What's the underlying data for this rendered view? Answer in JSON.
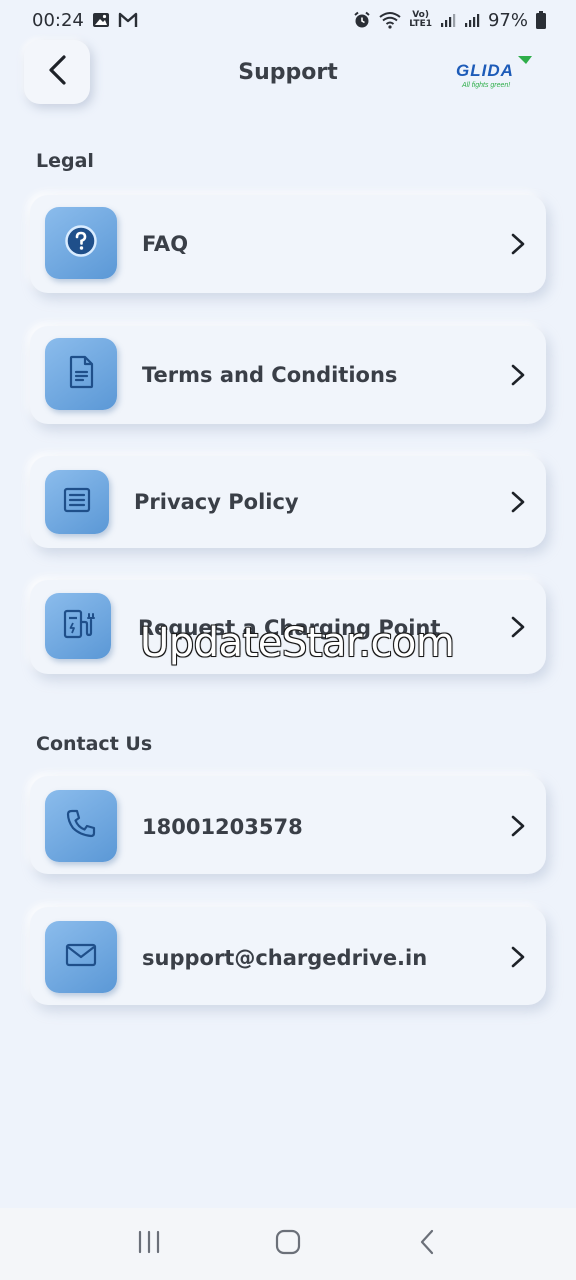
{
  "status_bar": {
    "time": "00:24",
    "battery": "97%",
    "icons": [
      "gallery-icon",
      "gmail-icon",
      "alarm-icon",
      "wifi-icon",
      "volte-icon",
      "signal-icon",
      "signal-icon",
      "battery-icon"
    ],
    "volte_line1": "Vo)",
    "volte_line2": "LTE1"
  },
  "header": {
    "title": "Support",
    "back_icon": "back-arrow-icon",
    "logo_text": "GLIDA",
    "logo_tagline": "All fights green!"
  },
  "sections": {
    "legal_label": "Legal",
    "contact_label": "Contact Us"
  },
  "legal_items": [
    {
      "label": "FAQ",
      "icon": "question-icon"
    },
    {
      "label": "Terms and Conditions",
      "icon": "document-icon"
    },
    {
      "label": "Privacy Policy",
      "icon": "list-document-icon"
    },
    {
      "label": "Request a Charging Point",
      "icon": "charging-station-icon"
    }
  ],
  "contact_items": [
    {
      "label": "18001203578",
      "icon": "phone-icon"
    },
    {
      "label": "support@chargedrive.in",
      "icon": "mail-icon"
    }
  ],
  "watermark": "UpdateStar.com",
  "colors": {
    "background": "#eef3fb",
    "icon_tile": "#6aa5de",
    "icon_stroke": "#1f4f8a",
    "logo_blue": "#1d5bb8",
    "logo_green": "#2fae4a"
  }
}
